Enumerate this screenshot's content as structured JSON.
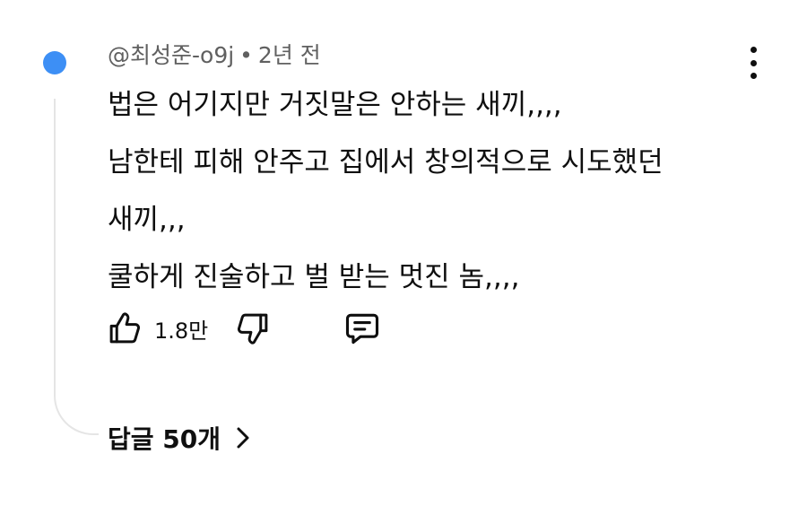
{
  "comment": {
    "author": "@최성준-o9j",
    "separator": "•",
    "time": "2년 전",
    "lines": [
      "법은 어기지만 거짓말은 안하는 새끼,,,,",
      "남한테 피해 안주고 집에서 창의적으로 시도했던",
      "새끼,,,",
      "쿨하게 진술하고 벌 받는 멋진 놈,,,,"
    ],
    "like_count": "1.8만",
    "replies_label": "답글 50개"
  },
  "icons": {
    "avatar_color": "#3d8ff5",
    "like": "thumb-up-icon",
    "dislike": "thumb-down-icon",
    "reply": "comment-icon",
    "more": "more-vertical-icon",
    "expand": "chevron-right-icon"
  }
}
